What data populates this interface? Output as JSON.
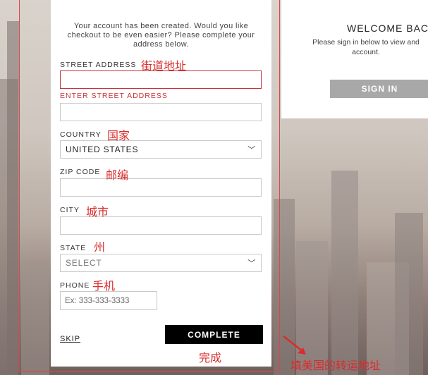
{
  "form": {
    "intro": "Your account has been created. Would you like checkout to be even easier? Please complete your address below.",
    "street_label": "STREET ADDRESS",
    "street_error": "ENTER STREET ADDRESS",
    "street_value": "",
    "street2_value": "",
    "country_label": "COUNTRY",
    "country_value": "UNITED STATES",
    "zip_label": "ZIP CODE",
    "zip_value": "",
    "city_label": "CITY",
    "city_value": "",
    "state_label": "STATE",
    "state_value": "SELECT",
    "phone_label": "PHONE",
    "phone_placeholder": "Ex: 333-333-3333",
    "skip_label": "SKIP",
    "complete_label": "COMPLETE"
  },
  "signin": {
    "title": "WELCOME BACK",
    "text": "Please sign in below to view and account.",
    "button": "SIGN IN"
  },
  "annotations": {
    "street": "街道地址",
    "country": "国家",
    "zip": "邮编",
    "city": "城市",
    "state": "州",
    "phone": "手机",
    "complete": "完成",
    "shipping": "填美国的转运地址"
  },
  "colors": {
    "annotation": "#d92c2c",
    "error": "#c8323a",
    "complete_button": "#000000",
    "signin_button": "#a8a8a8"
  },
  "icons": {
    "dropdown": "chevron-down-icon",
    "arrow": "arrow-icon"
  }
}
